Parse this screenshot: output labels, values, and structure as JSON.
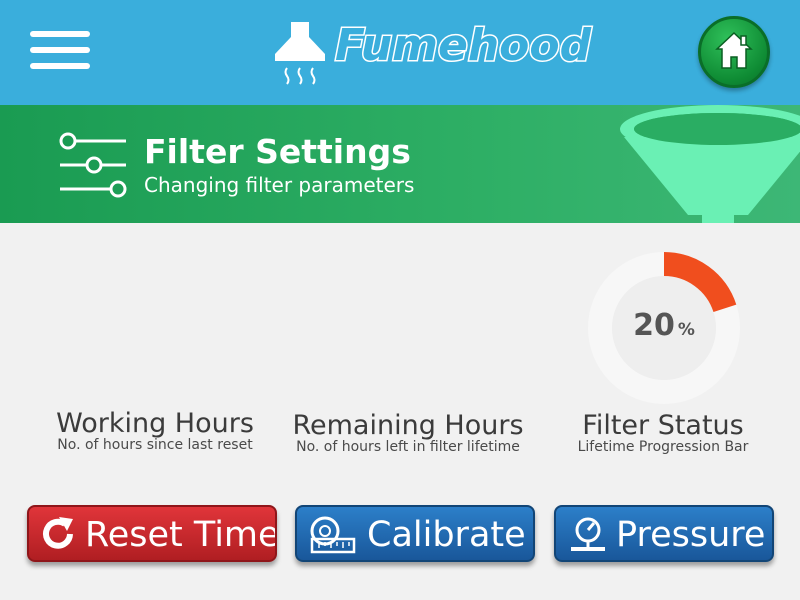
{
  "app": {
    "brand": "Fumehood"
  },
  "header": {
    "menu_icon": "hamburger-menu-icon",
    "home_icon": "home-icon"
  },
  "band": {
    "title": "Filter Settings",
    "subtitle": "Changing filter parameters",
    "icon": "sliders-icon",
    "decoration": "funnel-icon"
  },
  "stats": {
    "working": {
      "label": "Working Hours",
      "sub": "No. of hours since last reset"
    },
    "remaining": {
      "label": "Remaining Hours",
      "sub": "No. of hours left in filter lifetime"
    },
    "filter": {
      "label": "Filter Status",
      "sub": "Lifetime Progression Bar",
      "percent": "20",
      "percent_sign": "%",
      "progress": 0.2
    }
  },
  "buttons": {
    "reset": "Reset Time",
    "calibrate": "Calibrate",
    "pressure": "Pressure"
  },
  "colors": {
    "header": "#3aaedc",
    "band": "#1a9b52",
    "progress": "#f04e1e",
    "reset_button": "#c8262b",
    "blue_button": "#1f66ad",
    "home_button": "#16a043"
  }
}
